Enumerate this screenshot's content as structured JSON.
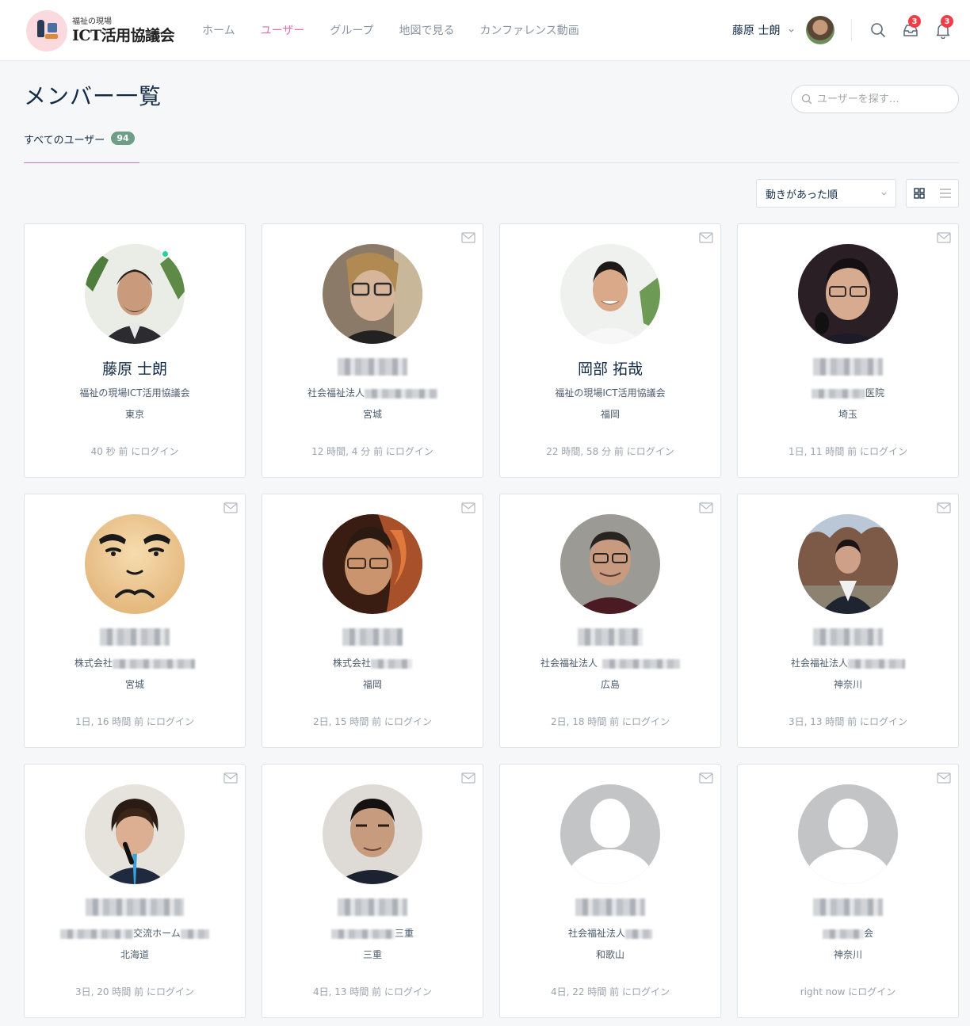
{
  "header": {
    "logo_sub": "福祉の現場",
    "logo_main": "ICT活用協議会",
    "nav": [
      {
        "label": "ホーム",
        "active": false
      },
      {
        "label": "ユーザー",
        "active": true
      },
      {
        "label": "グループ",
        "active": false
      },
      {
        "label": "地図で見る",
        "active": false
      },
      {
        "label": "カンファレンス動画",
        "active": false
      }
    ],
    "user_name": "藤原 士朗",
    "messages_badge": "3",
    "notifications_badge": "3"
  },
  "page": {
    "title": "メンバー一覧",
    "search_placeholder": "ユーザーを探す…",
    "tab_label": "すべてのユーザー",
    "tab_count": "94",
    "sort_label": "動きがあった順"
  },
  "colors": {
    "accent": "#e66ea8",
    "badge": "#ef3e46",
    "count_pill": "#6f9e87",
    "online": "#1cd991"
  },
  "members": [
    {
      "name": "藤原 士朗",
      "org": "福祉の現場ICT活用協議会",
      "pref": "東京",
      "login": "40 秒 前 にログイン",
      "online": true,
      "avatar": "photo-man-plants"
    },
    {
      "name": "",
      "org_prefix": "社会福祉法人",
      "org_suffix": "",
      "pref": "宮城",
      "login": "12 時間, 4 分 前 にログイン",
      "avatar": "photo-glasses-illustrated"
    },
    {
      "name": "岡部 拓哉",
      "org": "福祉の現場ICT活用協議会",
      "pref": "福岡",
      "login": "22 時間, 58 分 前 にログイン",
      "avatar": "photo-man-white-shirt"
    },
    {
      "name": "",
      "org_prefix": "",
      "org_suffix": "医院",
      "pref": "埼玉",
      "login": "1日, 11 時間 前 にログイン",
      "avatar": "photo-man-glasses-mic"
    },
    {
      "name": "",
      "org_prefix": "株式会社",
      "org_suffix": "",
      "pref": "宮城",
      "login": "1日, 16 時間 前 にログイン",
      "avatar": "illustration-face"
    },
    {
      "name": "",
      "org_prefix": "株式会社",
      "org_suffix": "",
      "pref": "福岡",
      "login": "2日, 15 時間 前 にログイン",
      "avatar": "photo-fire-effect"
    },
    {
      "name": "",
      "org_prefix": "社会福祉法人",
      "org_suffix": "",
      "pref": "広島",
      "login": "2日, 18 時間 前 にログイン",
      "avatar": "photo-man-maroon"
    },
    {
      "name": "",
      "org_prefix": "社会福祉法人",
      "org_suffix": "",
      "pref": "神奈川",
      "login": "3日, 13 時間 前 にログイン",
      "avatar": "photo-man-outdoor"
    },
    {
      "name": "",
      "org_prefix": "",
      "org_middle": "交流ホーム",
      "org_suffix": "",
      "pref": "北海道",
      "login": "3日, 20 時間 前 にログイン",
      "avatar": "photo-woman-mic"
    },
    {
      "name": "",
      "org_prefix": "",
      "org_suffix": "三重",
      "pref": "三重",
      "login": "4日, 13 時間 前 にログイン",
      "avatar": "photo-man-navy"
    },
    {
      "name": "",
      "org_prefix": "社会福祉法人",
      "org_suffix": "",
      "pref": "和歌山",
      "login": "4日, 22 時間 前 にログイン",
      "avatar": "default-silhouette"
    },
    {
      "name": "",
      "org_prefix": "",
      "org_suffix": "会",
      "pref": "神奈川",
      "login": "right now にログイン",
      "avatar": "default-silhouette"
    }
  ]
}
